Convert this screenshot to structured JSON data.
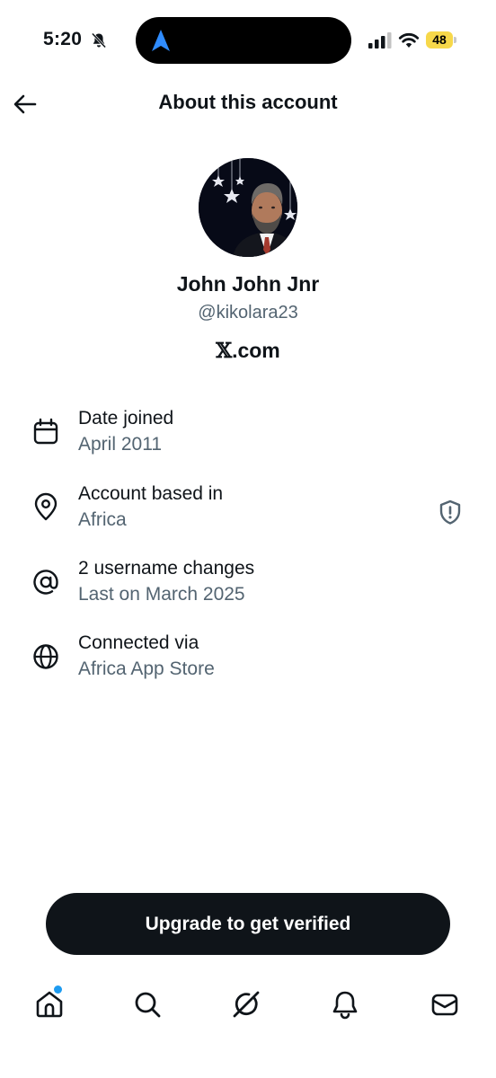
{
  "status_bar": {
    "time": "5:20",
    "battery_level": "48",
    "icons": [
      "bell-off-icon",
      "location-arrow-icon",
      "cellular-signal-icon",
      "wifi-icon",
      "battery-icon"
    ]
  },
  "header": {
    "title": "About this account",
    "back_icon": "arrow-left-icon"
  },
  "profile": {
    "display_name": "John John Jnr",
    "handle": "@kikolara23",
    "domain_mark": "𝕏",
    "domain_rest": ".com"
  },
  "info_rows": [
    {
      "icon": "calendar-icon",
      "title": "Date joined",
      "value": "April 2011"
    },
    {
      "icon": "location-pin-icon",
      "title": "Account based in",
      "value": "Africa",
      "trailing_icon": "shield-alert-icon"
    },
    {
      "icon": "at-sign-icon",
      "title": "2 username changes",
      "value": "Last on March 2025"
    },
    {
      "icon": "globe-icon",
      "title": "Connected via",
      "value": "Africa App Store"
    }
  ],
  "upgrade_button": {
    "label": "Upgrade to get verified"
  },
  "bottom_nav": {
    "items": [
      "home-icon",
      "search-icon",
      "grok-icon",
      "bell-icon",
      "mail-icon"
    ],
    "notification_dot_color": "#1d9bf0"
  },
  "colors": {
    "text_primary": "#0f1419",
    "text_secondary": "#536471",
    "battery_fill": "#f7d84a",
    "accent": "#1d9bf0"
  }
}
